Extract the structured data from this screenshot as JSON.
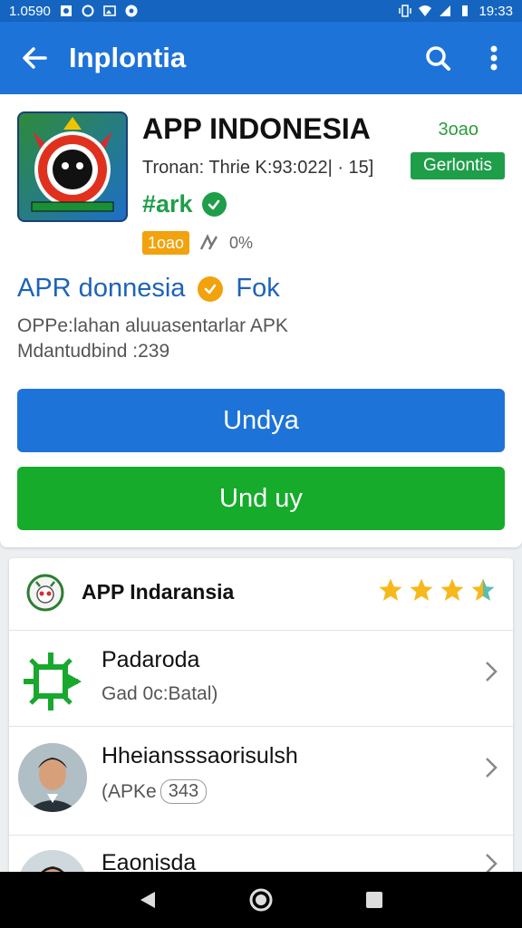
{
  "status_bar": {
    "left_text": "1.0590",
    "time": "19:33"
  },
  "app_bar": {
    "title": "Inplontia"
  },
  "app": {
    "name": "APP INDONESIA",
    "meta": "Tronan: Thrie K:93:022| · 15]",
    "size": "3oao",
    "badge": "Gerlontis",
    "tag": "#ark",
    "small_badge": "1oao",
    "small_pct": "0%",
    "developer": "APR donnesia",
    "developer_tag": "Fok",
    "description_line1": "OPPe:lahan aluuasentarlar APK",
    "description_line2": "Mdantudbind :239",
    "primary_button": "Undya",
    "secondary_button": "Und  uy"
  },
  "list": {
    "header_title": "APP Indaransia",
    "rating": 3.5,
    "items": [
      {
        "title": "Padaroda",
        "subtitle": "Gad 0c:Batal)",
        "pill": ""
      },
      {
        "title": "Hheiansssaorisulsh",
        "subtitle": "(APKe",
        "pill": "343"
      },
      {
        "title": "Eaonisda",
        "subtitle": "",
        "pill": ""
      }
    ]
  },
  "colors": {
    "primary": "#1e73d8",
    "green": "#16ab2b",
    "orange": "#f2a20c",
    "star": "#f7b81c"
  }
}
